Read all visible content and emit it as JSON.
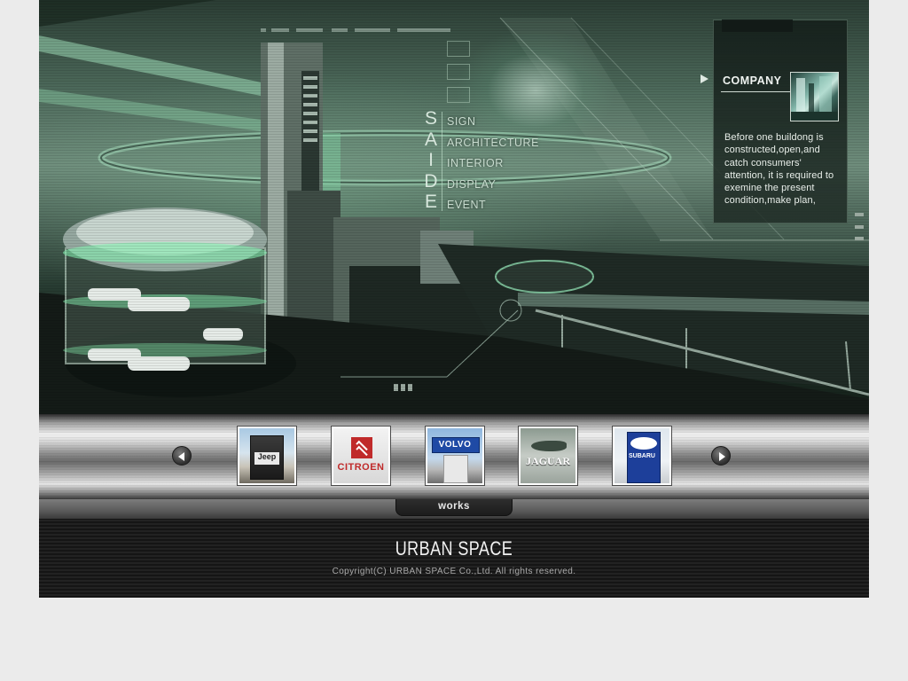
{
  "hero": {
    "saide_letters": [
      "S",
      "A",
      "I",
      "D",
      "E"
    ],
    "menu": [
      "SIGN",
      "ARCHITECTURE",
      "INTERIOR",
      "DISPLAY",
      "EVENT"
    ]
  },
  "company": {
    "title": "COMPANY",
    "text": "Before one buildong is constructed,open,and catch consumers' attention, it is required to exemine the present condition,make plan,"
  },
  "carousel": {
    "thumbs": [
      {
        "name": "jeep",
        "label": "Jeep"
      },
      {
        "name": "citroen",
        "label": "CITROEN"
      },
      {
        "name": "volvo",
        "label": "VOLVO"
      },
      {
        "name": "jaguar",
        "label": "JAGUAR"
      },
      {
        "name": "subaru",
        "label": "SUBARU"
      }
    ]
  },
  "works": {
    "label": "works"
  },
  "footer": {
    "brand": "URBAN SPACE",
    "copyright": "Copyright(C) URBAN SPACE Co.,Ltd. All rights reserved."
  },
  "colors": {
    "page_bg": "#ebebeb",
    "hero_green": "#4d6a5b",
    "footer_bg": "#1a1a1a"
  }
}
